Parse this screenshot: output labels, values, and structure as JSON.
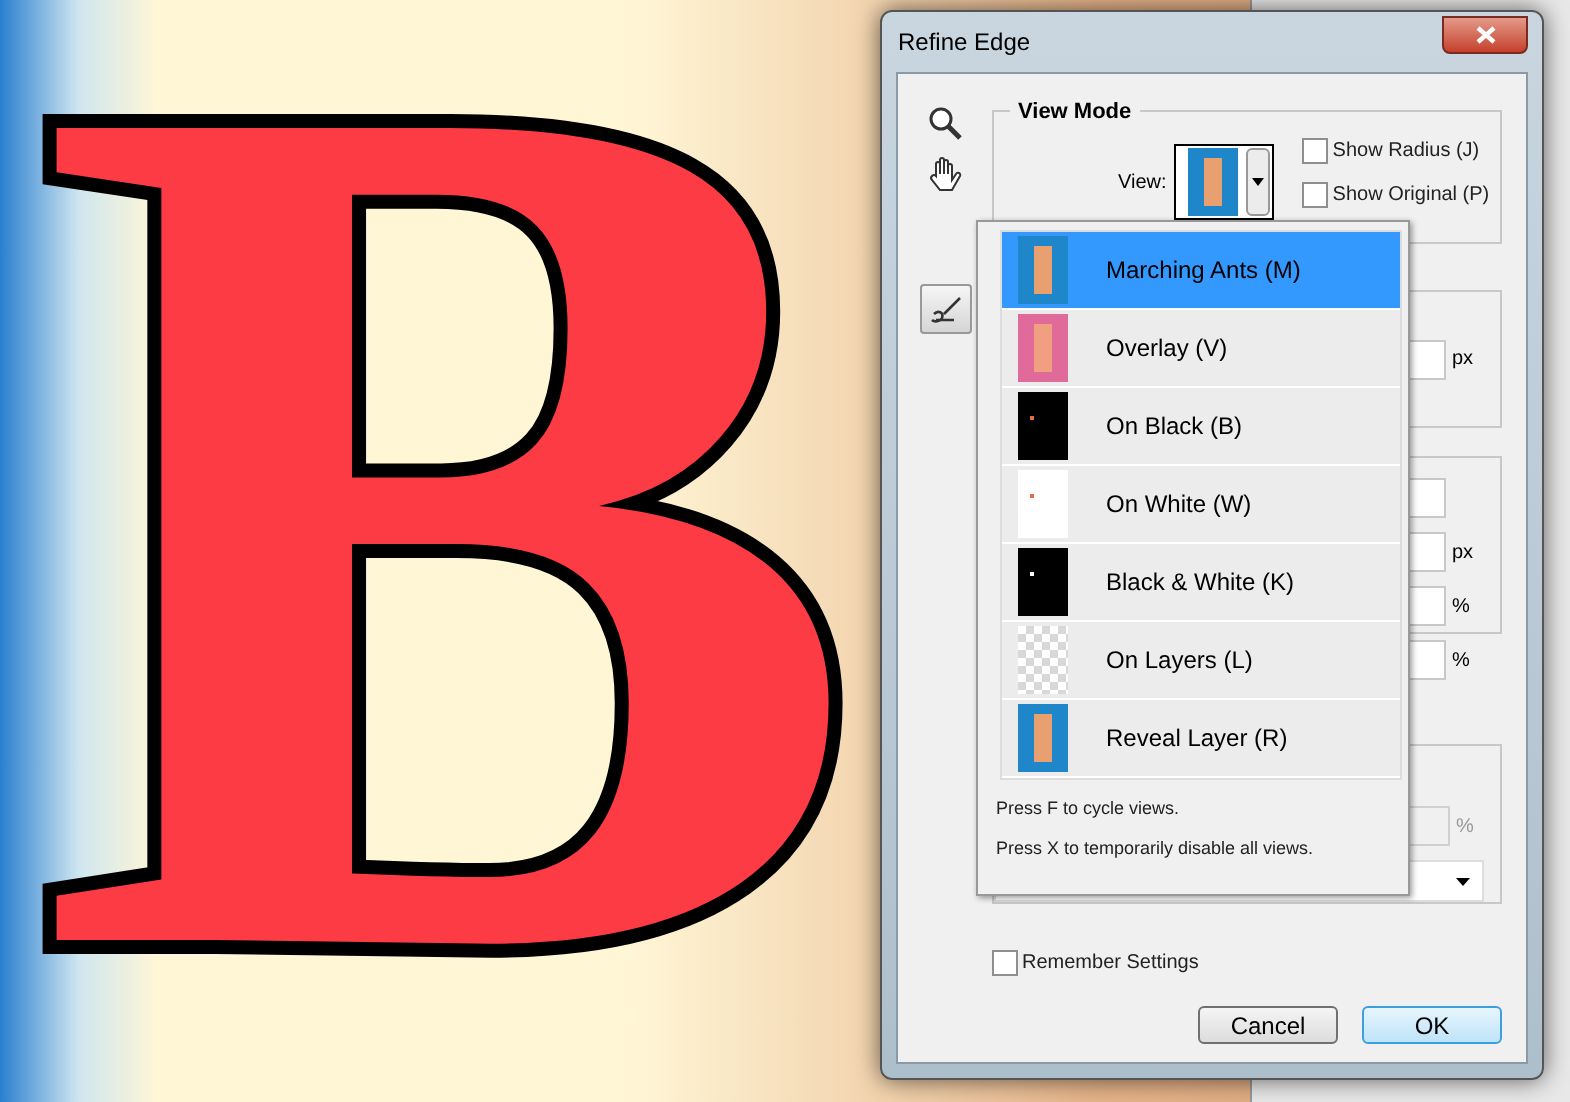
{
  "canvas": {
    "letter": "B"
  },
  "window": {
    "title": "Refine Edge"
  },
  "view_mode": {
    "title": "View Mode",
    "view_label": "View:",
    "options": [
      {
        "label": "Show Radius (J)",
        "checked": false
      },
      {
        "label": "Show Original (P)",
        "checked": false
      }
    ]
  },
  "view_menu": {
    "items": [
      {
        "label": "Marching Ants (M)",
        "kind": "photo",
        "selected": true
      },
      {
        "label": "Overlay (V)",
        "kind": "overlay",
        "selected": false
      },
      {
        "label": "On Black (B)",
        "kind": "black",
        "selected": false
      },
      {
        "label": "On White (W)",
        "kind": "white",
        "selected": false
      },
      {
        "label": "Black & White (K)",
        "kind": "mask",
        "selected": false
      },
      {
        "label": "On Layers (L)",
        "kind": "layers",
        "selected": false
      },
      {
        "label": "Reveal Layer (R)",
        "kind": "photo",
        "selected": false
      }
    ],
    "hints": [
      "Press F to cycle views.",
      "Press X to temporarily disable all views."
    ]
  },
  "edge_detection": {
    "fields": [
      {
        "unit": "px"
      }
    ]
  },
  "adjust_edge": {
    "fields": [
      {
        "kind": "plain"
      },
      {
        "kind": "unit",
        "unit": "px"
      },
      {
        "kind": "unit",
        "unit": "%"
      },
      {
        "kind": "unit",
        "unit": "%"
      }
    ]
  },
  "output": {
    "fields": [
      {
        "unit": "%",
        "disabled": true
      }
    ]
  },
  "remember_settings": {
    "label": "Remember Settings",
    "checked": false
  },
  "buttons": [
    {
      "label": "Cancel",
      "default": false
    },
    {
      "label": "OK",
      "default": true
    }
  ]
}
